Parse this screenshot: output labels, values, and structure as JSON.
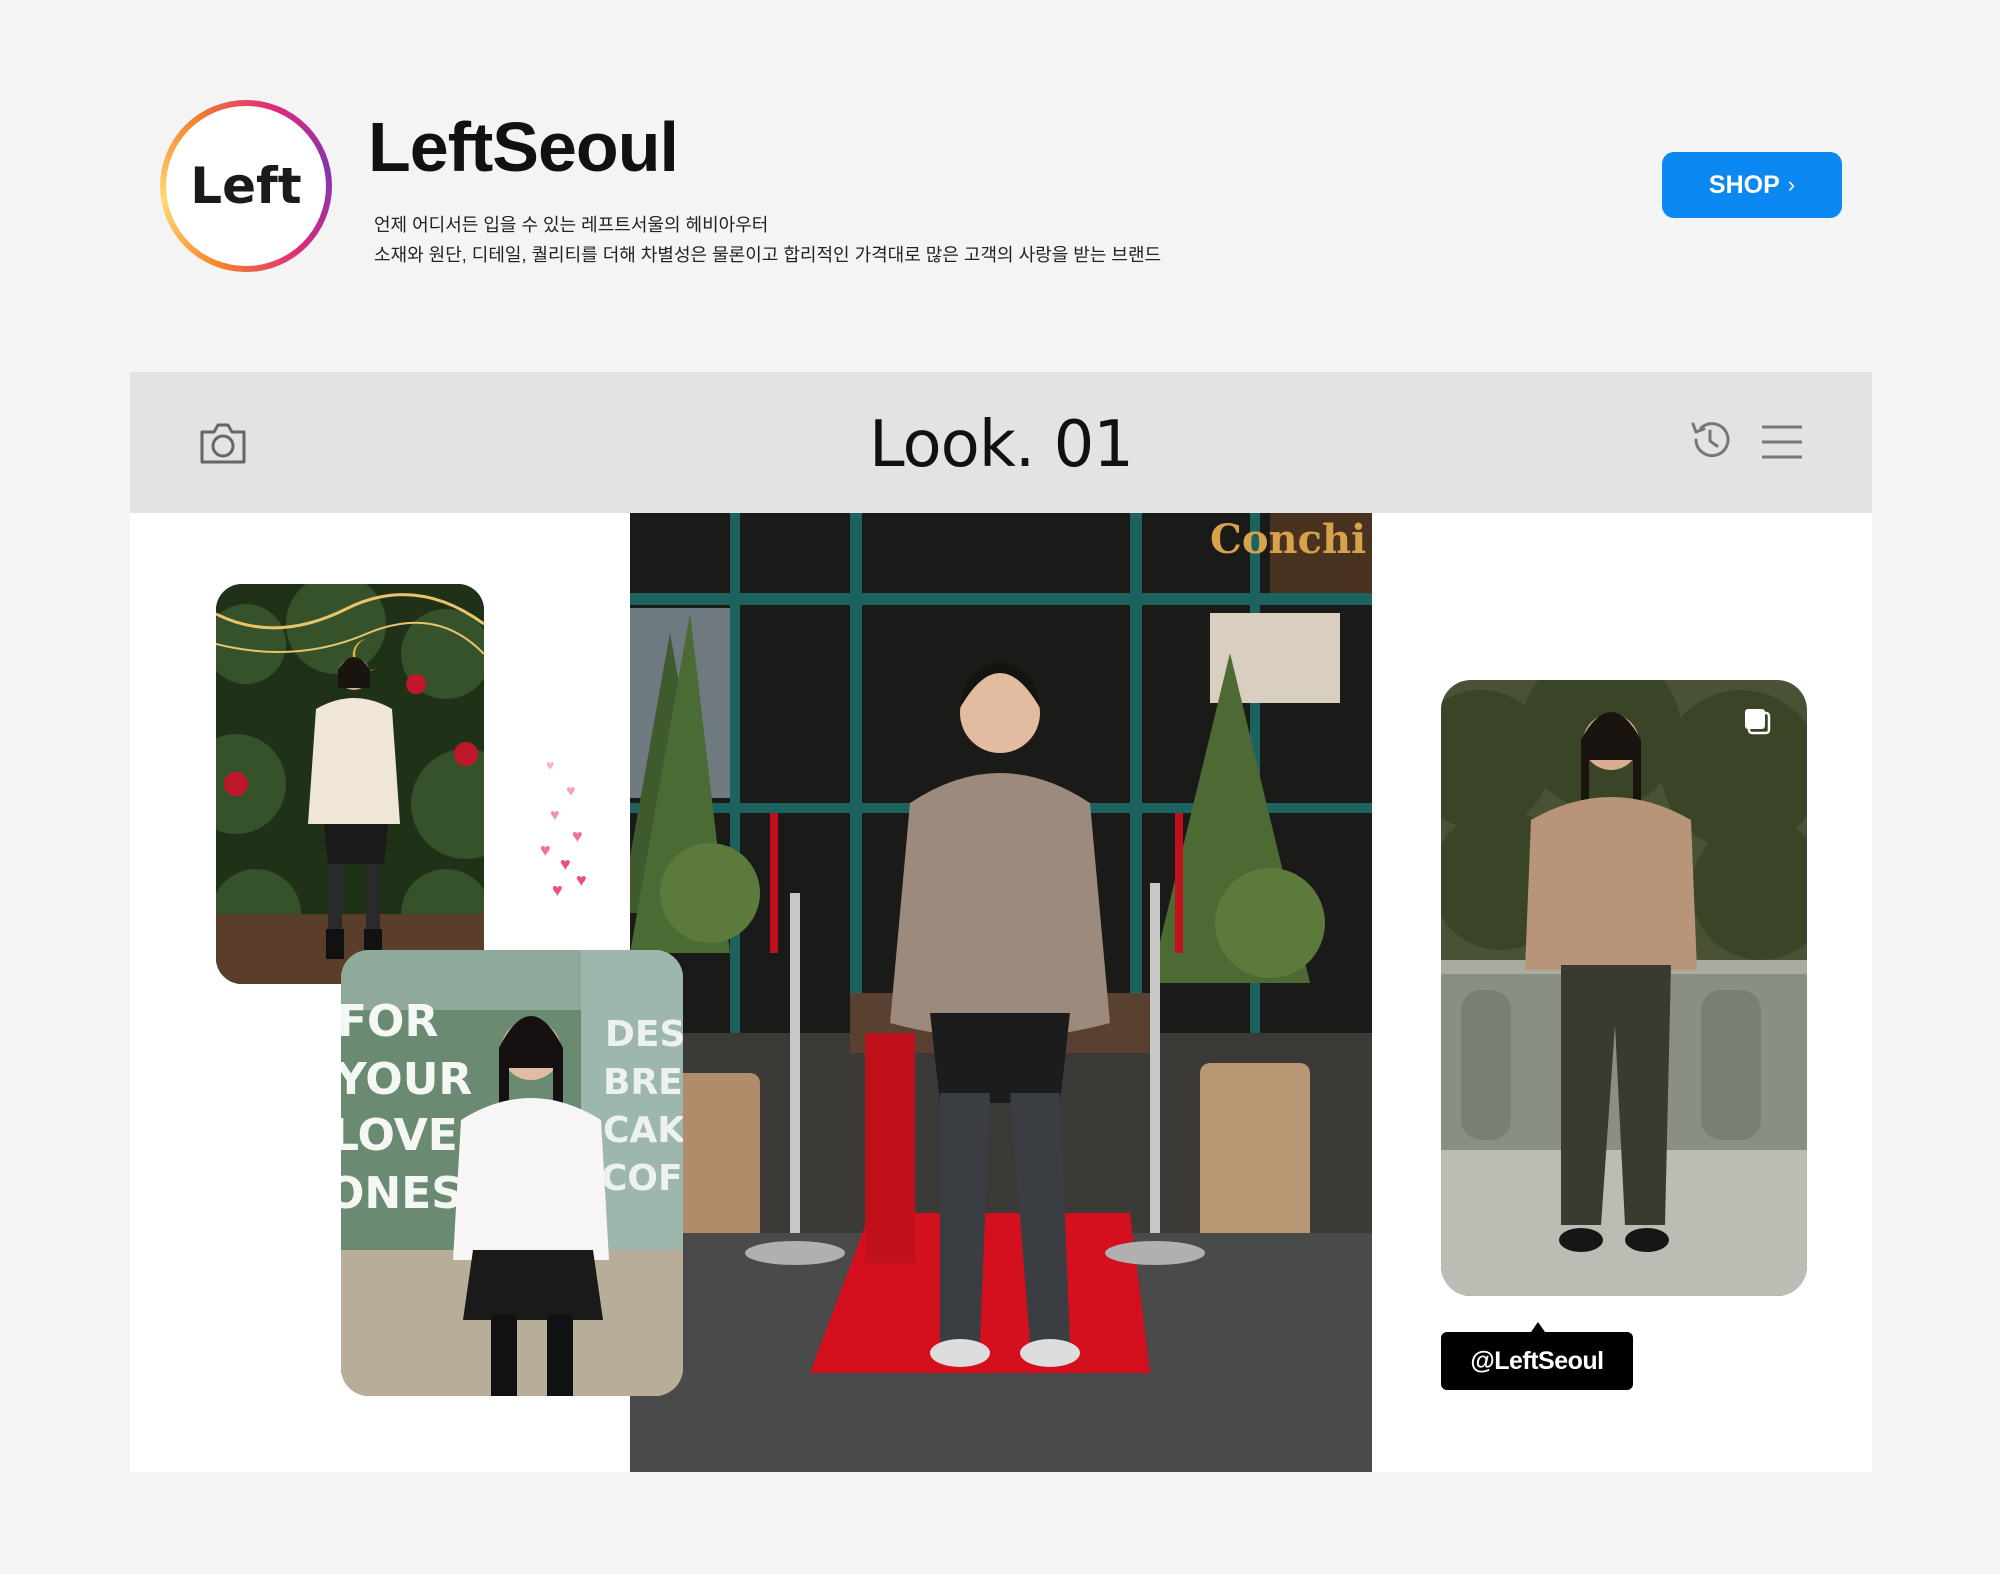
{
  "profile": {
    "avatar_text": "Left",
    "brand_name": "LeftSeoul",
    "description_line1": "언제 어디서든 입을 수 있는 레프트서울의 헤비아우터",
    "description_line2": "소재와 원단, 디테일, 퀄리티를 더해 차별성은 물론이고 합리적인 가격대로 많은 고객의 사랑을 받는 브랜드",
    "shop_label": "SHOP",
    "shop_chevron": "›",
    "shop_color": "#0b88f2",
    "ring_colors": [
      "#f58529",
      "#dd2a7b",
      "#8134af"
    ]
  },
  "feed": {
    "title": "Look. 01",
    "icons": [
      "camera-icon",
      "history-icon",
      "menu-icon"
    ],
    "handle": "@LeftSeoul",
    "photos": [
      {
        "name": "christmas-tree-look",
        "jacket_color": "cream"
      },
      {
        "name": "main-look",
        "jacket_color": "taupe"
      },
      {
        "name": "cafe-look",
        "jacket_color": "white"
      },
      {
        "name": "street-look",
        "jacket_color": "camel"
      }
    ],
    "cafe_window_text": [
      "FOR",
      "YOUR",
      "LOVE",
      "ONES",
      "DESS",
      "BREA",
      "CAKE",
      "COFF"
    ],
    "storefront_sign": "Conchi"
  }
}
